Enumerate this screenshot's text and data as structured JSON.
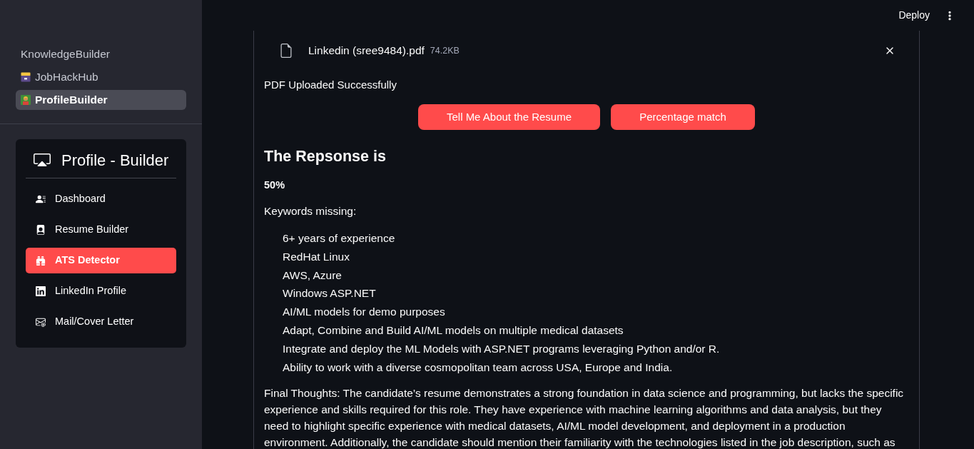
{
  "header": {
    "deploy": "Deploy"
  },
  "sidebar": {
    "pages": [
      {
        "label": "KnowledgeBuilder",
        "selected": false
      },
      {
        "label": "JobHackHub",
        "selected": false
      },
      {
        "label": "ProfileBuilder",
        "selected": true
      }
    ],
    "menu": {
      "title": "Profile - Builder",
      "items": [
        {
          "label": "Dashboard",
          "selected": false
        },
        {
          "label": "Resume Builder",
          "selected": false
        },
        {
          "label": "ATS Detector",
          "selected": true
        },
        {
          "label": "LinkedIn Profile",
          "selected": false
        },
        {
          "label": "Mail/Cover Letter",
          "selected": false
        }
      ]
    }
  },
  "upload": {
    "file_name": "Linkedin (sree9484).pdf",
    "file_size": "74.2KB",
    "status": "PDF Uploaded Successfully"
  },
  "buttons": [
    "Tell Me About the Resume",
    "Percentage match"
  ],
  "response": {
    "heading": "The Repsonse is",
    "score": "50%",
    "keywords_label": "Keywords missing:",
    "keywords": [
      "6+ years of experience",
      "RedHat Linux",
      "AWS, Azure",
      "Windows ASP.NET",
      "AI/ML models for demo purposes",
      "Adapt, Combine and Build AI/ML models on multiple medical datasets",
      "Integrate and deploy the ML Models with ASP.NET programs leveraging Python and/or R.",
      "Ability to work with a diverse cosmopolitan team across USA, Europe and India."
    ],
    "final_thoughts": "Final Thoughts: The candidate’s resume demonstrates a strong foundation in data science and programming, but lacks the specific experience and skills required for this role. They have experience with machine learning algorithms and data analysis, but they need to highlight specific experience with medical datasets, AI/ML model development, and deployment in a production environment. Additionally, the candidate should mention their familiarity with the technologies listed in the job description, such as"
  }
}
